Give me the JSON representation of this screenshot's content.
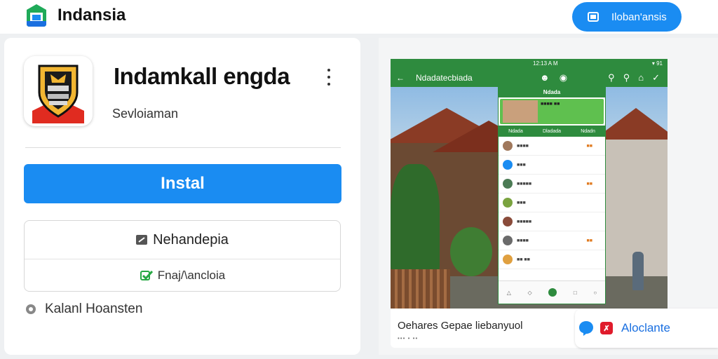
{
  "header": {
    "brand_name": "Indansia",
    "action_button": "Iloban'ansis"
  },
  "app": {
    "title": "Indamkall engda",
    "subtitle": "Sevloiaman",
    "install_label": "Instal",
    "option_primary": "Nehandepia",
    "option_secondary": "Fnaj/\\ancloia",
    "extra_info": "Kalanl Hoansten"
  },
  "preview": {
    "phone_status_left": "",
    "phone_status_center": "12:13 A M",
    "phone_status_right": "▾ 91",
    "phone_title": "Ndadatecbiada",
    "chat_header": "Ndada",
    "chat_tabs": [
      "Ndada",
      "Dladada",
      "Ndadn"
    ],
    "caption": "Oehares Gepae liebanyuol",
    "caption_sub": "••• • ••",
    "follow_label": "Aloclante"
  },
  "colors": {
    "primary_blue": "#1a8cf2",
    "whatsapp_green": "#2e8b3e",
    "badge_red": "#e01b2b"
  }
}
